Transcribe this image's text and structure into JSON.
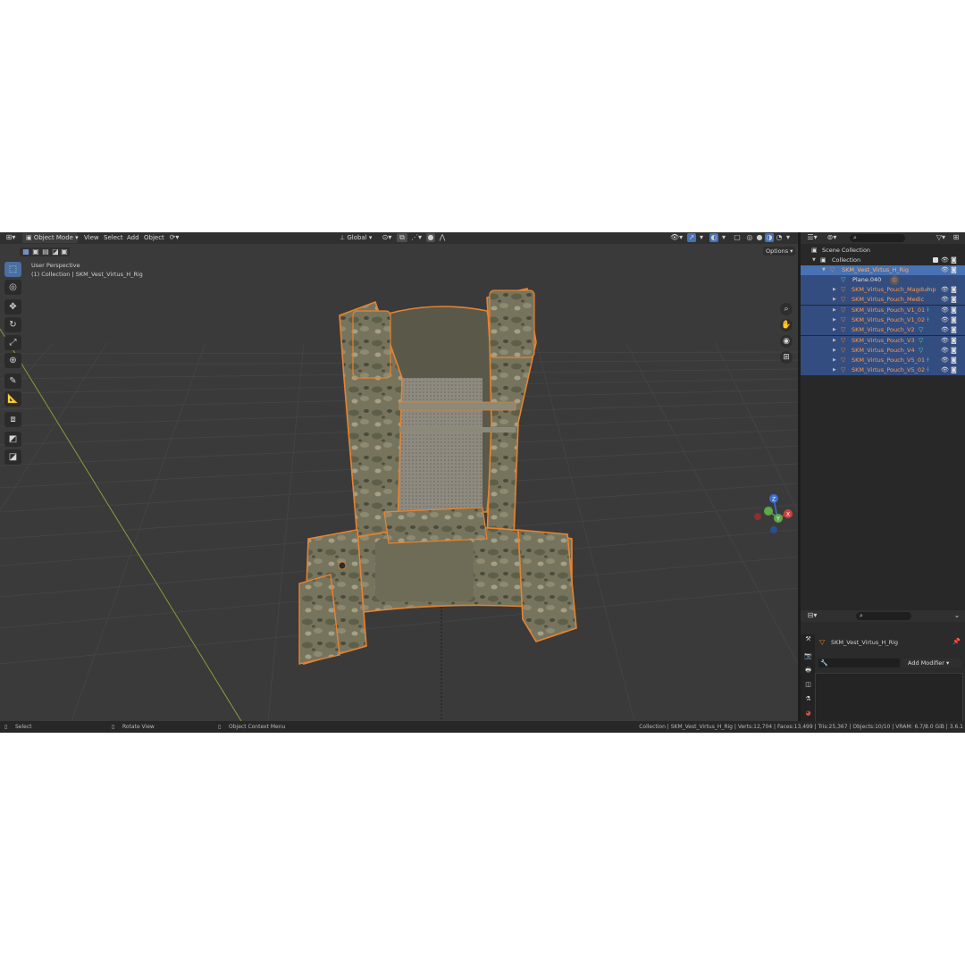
{
  "header": {
    "mode": "Object Mode",
    "menus": [
      "View",
      "Select",
      "Add",
      "Object"
    ],
    "transform_orientation": "Global"
  },
  "viewport": {
    "view_name": "User Perspective",
    "context": "(1) Collection | SKM_Vest_Virtus_H_Rig",
    "options_label": "Options",
    "gizmo_axes": [
      "Z",
      "Y",
      "X"
    ]
  },
  "outliner": {
    "scene_collection": "Scene Collection",
    "collection": "Collection",
    "rig": "SKM_Vest_Virtus_H_Rig",
    "plane": "Plane.040",
    "children": [
      "SKM_Virtus_Pouch_Magdump",
      "SKM_Virtus_Pouch_Medic",
      "SKM_Virtus_Pouch_V1_01",
      "SKM_Virtus_Pouch_V1_02",
      "SKM_Virtus_Pouch_V2",
      "SKM_Virtus_Pouch_V3",
      "SKM_Virtus_Pouch_V4",
      "SKM_Virtus_Pouch_V5_01",
      "SKM_Virtus_Pouch_V5_02"
    ]
  },
  "properties": {
    "object_name": "SKM_Vest_Virtus_H_Rig",
    "add_modifier": "Add Modifier"
  },
  "status": {
    "select": "Select",
    "rotate": "Rotate View",
    "context_menu": "Object Context Menu",
    "stats": "Collection | SKM_Vest_Virtus_H_Rig | Verts:12,704 | Faces:13,499 | Tris:25,367 | Objects:10/10 | VRAM: 6.7/8.0 GiB | 3.6.1"
  },
  "colors": {
    "selection_outline": "#e8832e",
    "active_row": "#4772b3",
    "selected_row": "#334d80"
  }
}
